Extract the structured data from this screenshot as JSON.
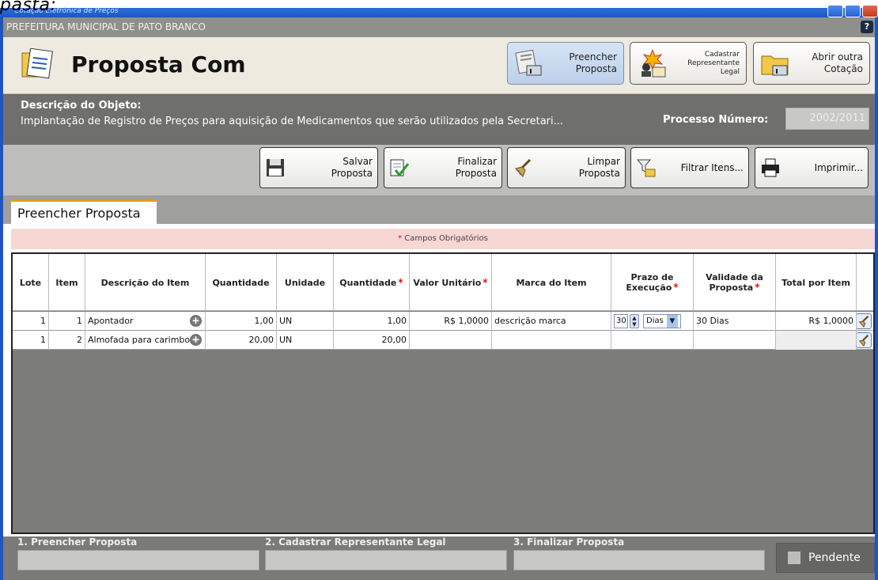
{
  "window": {
    "title_crop": "pasta:",
    "title_sub": "Cotação Eletrônica de Preços"
  },
  "org_bar": {
    "text": "PREFEITURA MUNICIPAL DE PATO BRANCO",
    "help": "?"
  },
  "header": {
    "title": "Proposta Com",
    "buttons": [
      {
        "label_line1": "Preencher",
        "label_line2": "Proposta",
        "icon": "form-fill-icon",
        "active": true
      },
      {
        "label_line1": "Cadastrar",
        "label_line2": "Representante",
        "label_line3": "Legal",
        "icon": "representative-icon"
      },
      {
        "label_line1": "Abrir outra",
        "label_line2": "Cotação",
        "icon": "open-folder-icon"
      }
    ]
  },
  "description": {
    "label": "Descrição do Objeto:",
    "text": "Implantação de Registro de Preços para aquisição de Medicamentos que serão utilizados pela Secretari...",
    "process_label": "Processo Número:",
    "process_value": "2002/2011"
  },
  "toolbar": {
    "save": {
      "l1": "Salvar",
      "l2": "Proposta"
    },
    "finalize": {
      "l1": "Finalizar",
      "l2": "Proposta"
    },
    "clear": {
      "l1": "Limpar",
      "l2": "Proposta"
    },
    "filter": "Filtrar Itens...",
    "print": "Imprimir..."
  },
  "tab": {
    "label": "Preencher Proposta"
  },
  "required_note": {
    "star": "*",
    "text": " Campos Obrigatórios"
  },
  "table": {
    "headers": {
      "lote": "Lote",
      "item": "Item",
      "descricao": "Descrição do Item",
      "quantidade": "Quantidade",
      "unidade": "Unidade",
      "quantidade2": "Quantidade",
      "valor": "Valor Unitário",
      "marca": "Marca do Item",
      "prazo1": "Prazo de",
      "prazo2": "Execução",
      "validade1": "Validade da",
      "validade2": "Proposta",
      "total": "Total por Item",
      "star": "*"
    },
    "rows": [
      {
        "lote": "1",
        "item": "1",
        "descricao": "Apontador",
        "quantidade": "1,00",
        "unidade": "UN",
        "quantidade2": "1,00",
        "valor": "R$ 1,0000",
        "marca": "descrição marca",
        "prazo_num": "30",
        "prazo_unit": "Dias",
        "validade": "30 Dias",
        "total": "R$ 1,0000"
      },
      {
        "lote": "1",
        "item": "2",
        "descricao": "Almofada para carimbo;",
        "quantidade": "20,00",
        "unidade": "UN",
        "quantidade2": "20,00",
        "valor": "",
        "marca": "",
        "prazo_num": "",
        "prazo_unit": "",
        "validade": "",
        "total": ""
      }
    ]
  },
  "footer": {
    "step1": "1. Preencher Proposta",
    "step2": "2. Cadastrar Representante Legal",
    "step3": "3. Finalizar Proposta",
    "status": "Pendente"
  },
  "colors": {
    "accent": "#f4a000",
    "frame_blue": "#1d55c4",
    "required_bg": "#f7d7d3"
  }
}
